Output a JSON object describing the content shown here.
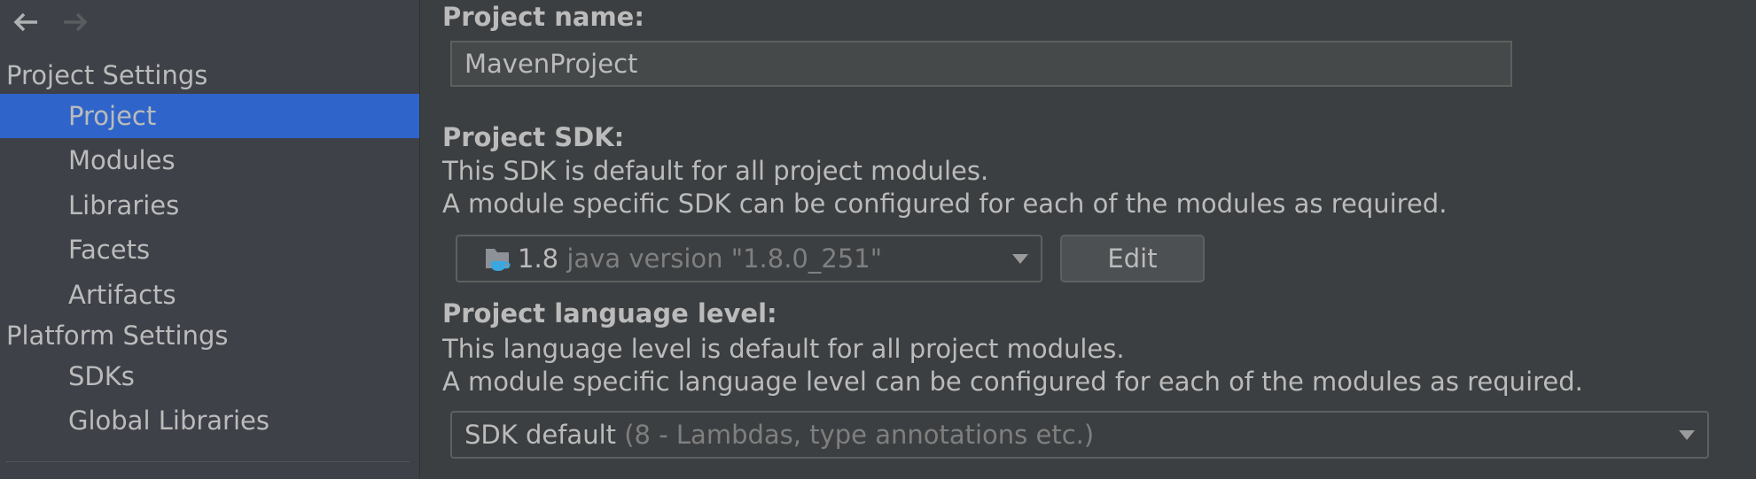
{
  "sidebar": {
    "nav": {
      "back_icon": "arrow-left-icon",
      "forward_icon": "arrow-right-icon"
    },
    "groups": [
      {
        "header": "Project Settings",
        "items": [
          {
            "label": "Project",
            "selected": true
          },
          {
            "label": "Modules"
          },
          {
            "label": "Libraries"
          },
          {
            "label": "Facets"
          },
          {
            "label": "Artifacts"
          }
        ]
      },
      {
        "header": "Platform Settings",
        "items": [
          {
            "label": "SDKs"
          },
          {
            "label": "Global Libraries"
          }
        ]
      }
    ]
  },
  "main": {
    "project_name": {
      "label": "Project name:",
      "value": "MavenProject"
    },
    "project_sdk": {
      "label": "Project SDK:",
      "desc_line1": "This SDK is default for all project modules.",
      "desc_line2": "A module specific SDK can be configured for each of the modules as required.",
      "selected_version": "1.8",
      "selected_detail": "java version \"1.8.0_251\"",
      "icon": "java-sdk-folder-icon",
      "edit_label": "Edit"
    },
    "language_level": {
      "label": "Project language level:",
      "desc_line1": "This language level is default for all project modules.",
      "desc_line2": "A module specific language level can be configured for each of the modules as required.",
      "selected_value": "SDK default",
      "selected_detail": "(8 - Lambdas, type annotations etc.)"
    }
  },
  "colors": {
    "selection": "#2f65ca",
    "background": "#3c3f41",
    "sidebar_background": "#3e4148",
    "text": "#bbbbbb",
    "muted_text": "#7f7f7f",
    "java_cup": "#3ba7e0"
  }
}
